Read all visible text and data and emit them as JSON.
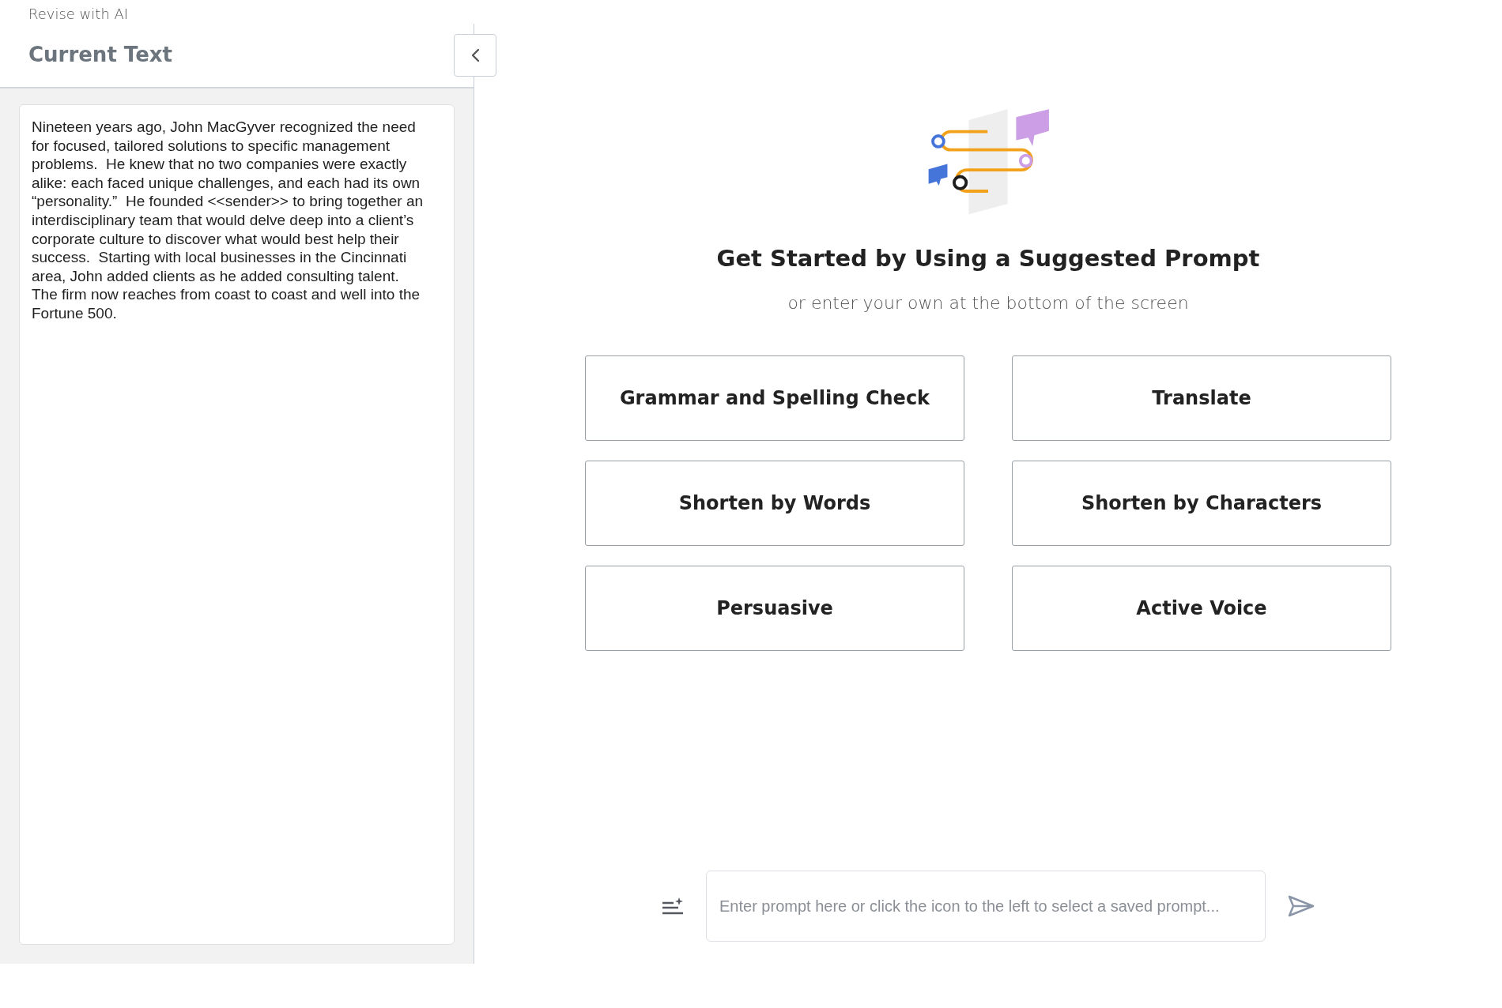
{
  "app_title": "Revise with AI",
  "current_text": {
    "heading": "Current Text",
    "body": "Nineteen years ago, John MacGyver recognized the need for focused, tailored solutions to specific management problems.  He knew that no two companies were exactly alike: each faced unique challenges, and each had its own “personality.”  He founded <<sender>> to bring together an interdisciplinary team that would delve deep into a client’s corporate culture to discover what would best help their success.  Starting with local businesses in the Cincinnati area, John added clients as he added consulting talent.  The firm now reaches from coast to coast and well into the Fortune 500."
  },
  "intro": {
    "title": "Get Started by Using a Suggested Prompt",
    "subtitle": "or enter your own at the bottom of the screen"
  },
  "suggested_prompts": [
    "Grammar and Spelling Check",
    "Translate",
    "Shorten by Words",
    "Shorten by Characters",
    "Persuasive",
    "Active Voice"
  ],
  "prompt_input": {
    "placeholder": "Enter prompt here or click the icon to the left to select a saved prompt..."
  }
}
